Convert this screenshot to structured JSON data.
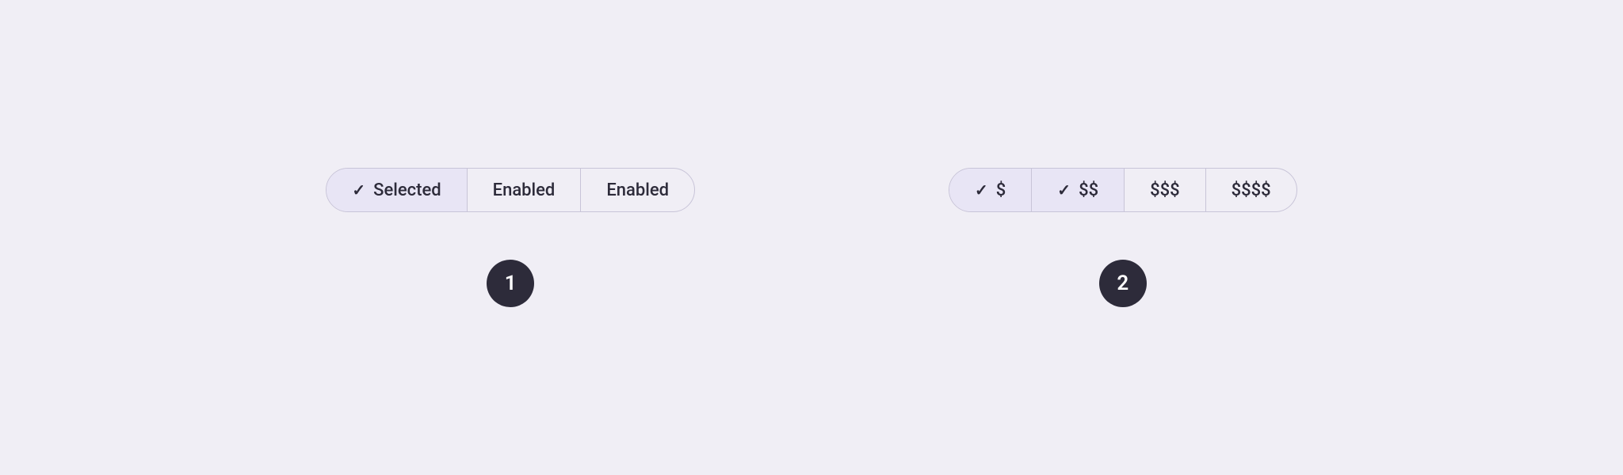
{
  "page": {
    "background": "#f0eef5"
  },
  "demo1": {
    "segments": [
      {
        "id": "selected",
        "label": "Selected",
        "state": "selected",
        "hasCheck": true
      },
      {
        "id": "enabled1",
        "label": "Enabled",
        "state": "enabled",
        "hasCheck": false
      },
      {
        "id": "enabled2",
        "label": "Enabled",
        "state": "enabled",
        "hasCheck": false
      }
    ],
    "badge": "1"
  },
  "demo2": {
    "segments": [
      {
        "id": "dollar1",
        "label": "$",
        "state": "selected",
        "hasCheck": true
      },
      {
        "id": "dollar2",
        "label": "$$",
        "state": "checked-secondary",
        "hasCheck": true
      },
      {
        "id": "dollar3",
        "label": "$$$",
        "state": "enabled",
        "hasCheck": false
      },
      {
        "id": "dollar4",
        "label": "$$$$",
        "state": "enabled",
        "hasCheck": false
      }
    ],
    "badge": "2"
  }
}
